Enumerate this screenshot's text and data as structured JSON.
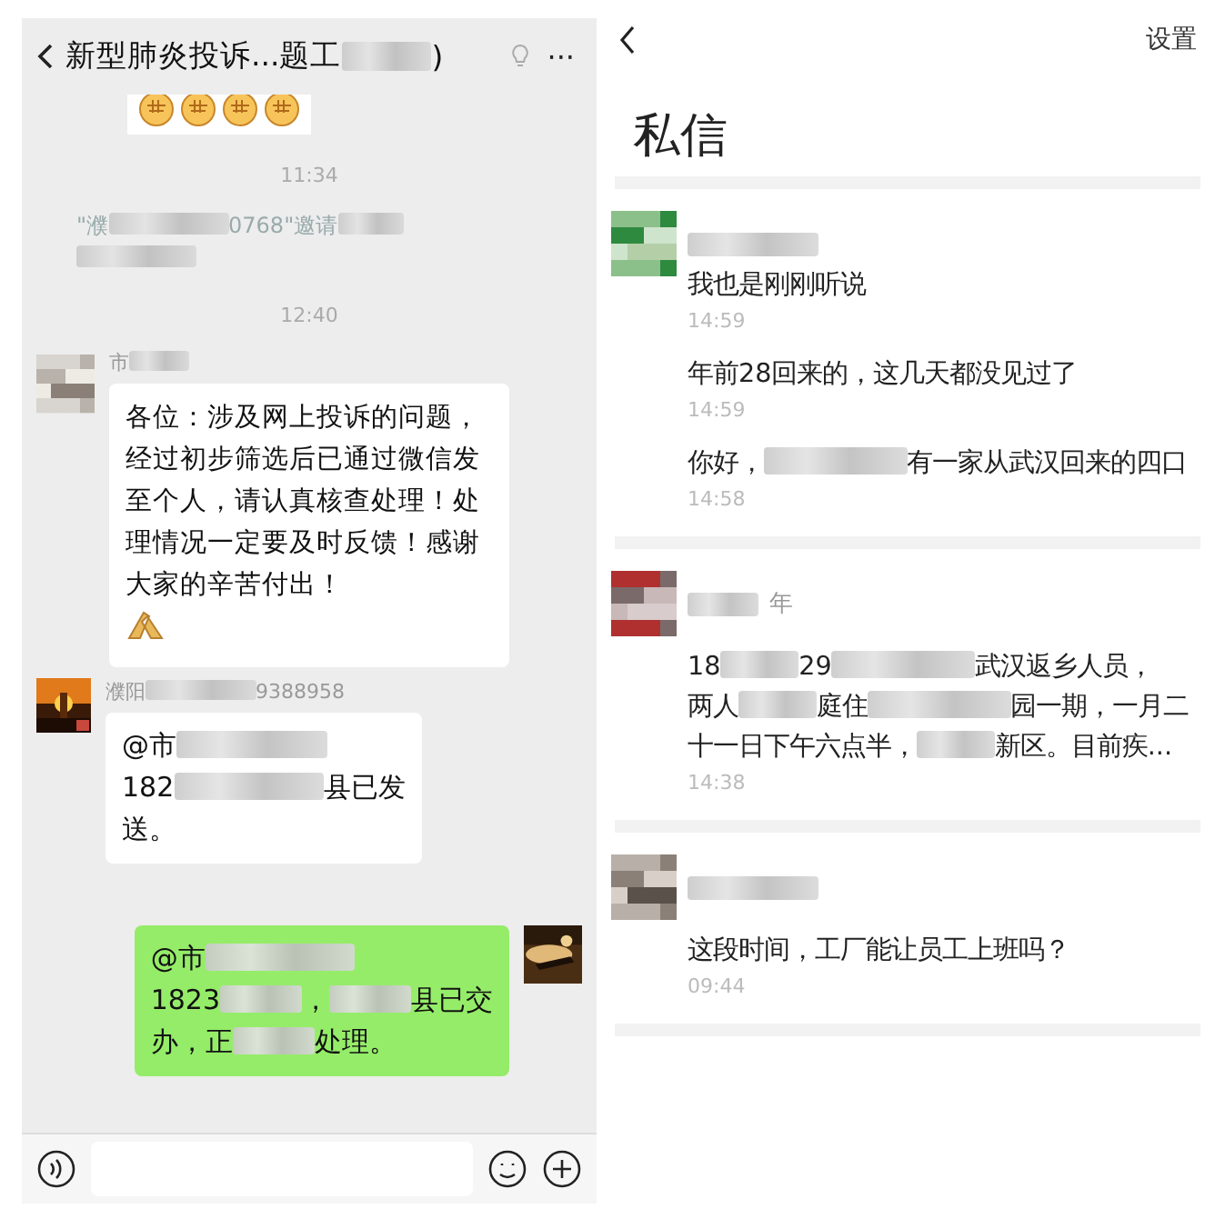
{
  "left_chat": {
    "title": [
      "新型肺炎投诉...题工",
      {
        "kind": "blur"
      },
      ")"
    ],
    "more": "···",
    "messages": [
      {
        "kind": "emoji_tail"
      },
      {
        "kind": "time",
        "text": "11:34"
      },
      {
        "kind": "system",
        "lines": [
          [
            "\"濮",
            {
              "kind": "blur_wide"
            },
            "0768\"邀请",
            {
              "kind": "blur"
            }
          ],
          [
            {
              "kind": "blur_wide"
            }
          ]
        ]
      },
      {
        "kind": "time",
        "text": "12:40"
      },
      {
        "kind": "incoming",
        "avatar": {
          "kind": "blurred"
        },
        "sender": [
          "市",
          {
            "kind": "blur"
          }
        ],
        "text": "各位：涉及网上投诉的问题，经过初步筛选后已通过微信发至个人，请认真核查处理！处理情况一定要及时反馈！感谢大家的辛苦付出！",
        "emoji": true
      },
      {
        "kind": "incoming",
        "avatar": {
          "kind": "picture"
        },
        "sender": [
          "濮阳",
          {
            "kind": "blur_wide"
          },
          "9388958"
        ],
        "lines": [
          [
            "@市",
            {
              "kind": "blur_wide"
            }
          ],
          [
            "182",
            {
              "kind": "blur_wide"
            },
            "县已发"
          ],
          [
            "送。"
          ]
        ]
      },
      {
        "kind": "outgoing",
        "avatar": {
          "kind": "picture"
        },
        "lines": [
          [
            "@市",
            {
              "kind": "blur_wide"
            }
          ],
          [
            "1823",
            {
              "kind": "blur"
            },
            "，",
            {
              "kind": "blur"
            },
            "县已交"
          ],
          [
            "办，正",
            {
              "kind": "blur"
            },
            "处理。"
          ]
        ]
      }
    ]
  },
  "right_inbox": {
    "settings": "设置",
    "title": "私信",
    "threads": [
      {
        "name": [
          {
            "kind": "blur_wide"
          }
        ],
        "messages": [
          {
            "lines": [
              [
                "我也是刚刚听说"
              ]
            ],
            "time": "14:59"
          },
          {
            "lines": [
              [
                "年前28回来的，这几天都没见过了"
              ]
            ],
            "time": "14:59"
          },
          {
            "lines": [
              [
                "你好，",
                {
                  "kind": "blur_wide"
                },
                "有一家从武汉回来的四口"
              ]
            ],
            "time": "14:58"
          }
        ]
      },
      {
        "name": [
          {
            "kind": "blur"
          },
          "年"
        ],
        "messages": [
          {
            "lines": [
              [
                "18",
                {
                  "kind": "blur"
                },
                "29",
                {
                  "kind": "blur_wide"
                },
                "武汉返乡人员，"
              ],
              [
                "两人",
                {
                  "kind": "blur"
                },
                "庭住",
                {
                  "kind": "blur_wide"
                },
                "园一期，一月二"
              ],
              [
                "十一日下午六点半，",
                {
                  "kind": "blur"
                },
                "新区。目前疾..."
              ]
            ],
            "time": "14:38"
          }
        ]
      },
      {
        "name": [
          {
            "kind": "blur_wide"
          }
        ],
        "messages": [
          {
            "lines": [
              [
                "这段时间，工厂能让员工上班吗？"
              ]
            ],
            "time": "09:44"
          }
        ]
      }
    ]
  }
}
